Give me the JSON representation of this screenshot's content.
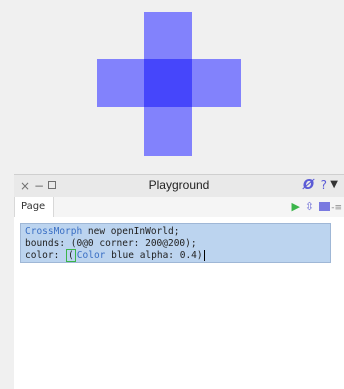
{
  "world": {
    "cross_color": "#6666ff"
  },
  "playground": {
    "title": "Playground",
    "window_controls": {
      "close": "×",
      "minimize": "−"
    },
    "header_icons": {
      "pref": "Ø",
      "help": "?",
      "menu": "▼"
    },
    "tab_label": "Page",
    "toolbar_icons": {
      "run": "▶",
      "bindings": "⇳",
      "more": "-≡"
    },
    "code": {
      "line1_class": "CrossMorph",
      "line1_rest": " new openInWorld;",
      "line2": "bounds: (0@0 corner: 200@200);",
      "line3_start": "color: ",
      "line3_paren": "(",
      "line3_class": "Color",
      "line3_rest": " blue alpha: 0.4)"
    }
  }
}
